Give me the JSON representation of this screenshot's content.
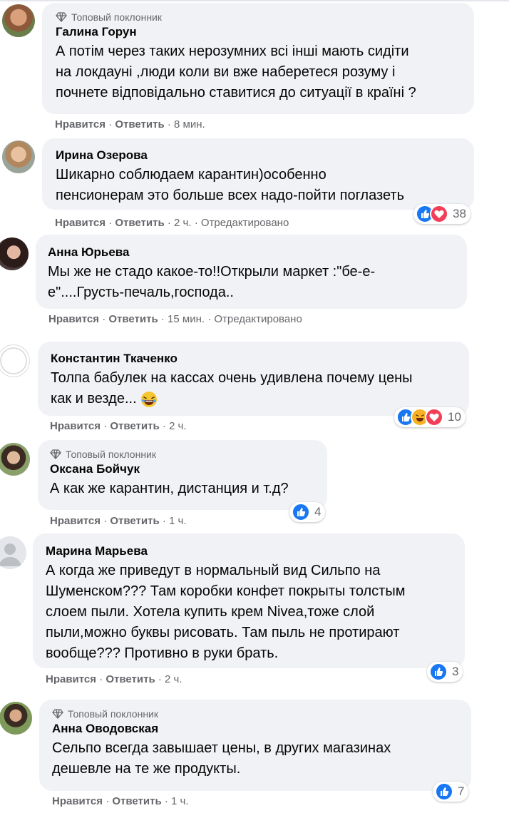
{
  "badge_label": "Топовый поклонник",
  "action_like": "Нравится",
  "action_reply": "Ответить",
  "separator": "·",
  "colors": {
    "bubble": "#f0f2f5",
    "meta": "#65676b",
    "like": "#1877f2",
    "love": "#f33e58",
    "haha": "#f7b125"
  },
  "comments": [
    {
      "author": "Галина Горун",
      "top_fan": true,
      "lines": [
        "А потім через таких нерозумних всі інші мають сидіти",
        "на локдауні ,люди коли ви вже наберетеся розуму і",
        "почнете відповідально ставитися до ситуації в країні ?"
      ],
      "time": "8 мин.",
      "edited": "",
      "reactions": null
    },
    {
      "author": "Ирина Озерова",
      "top_fan": false,
      "lines": [
        "Шикарно соблюдаем карантин)особенно",
        "пенсионерам это больше всех надо-пойти поглазеть"
      ],
      "time": "2 ч.",
      "edited": "Отредактировано",
      "reactions": {
        "icons": [
          "like-icon",
          "love-icon"
        ],
        "count": "38"
      }
    },
    {
      "author": "Анна Юрьева",
      "top_fan": false,
      "lines": [
        "Мы же не стадо какое-то!!Открыли маркет :\"бе-е-",
        "е\"....Грусть-печаль,господа.."
      ],
      "time": "15 мин.",
      "edited": "Отредактировано",
      "reactions": null
    },
    {
      "author": "Константин Ткаченко",
      "top_fan": false,
      "lines": [
        "Толпа бабулек на кассах очень удивлена почему цены",
        "как и везде..."
      ],
      "time": "2 ч.",
      "edited": "",
      "reactions": {
        "icons": [
          "like-icon",
          "haha-icon",
          "love-icon"
        ],
        "count": "10"
      }
    },
    {
      "author": "Оксана Бойчук",
      "top_fan": true,
      "lines": [
        "А как же карантин, дистанция и т.д?"
      ],
      "time": "1 ч.",
      "edited": "",
      "reactions": {
        "icons": [
          "like-icon"
        ],
        "count": "4"
      }
    },
    {
      "author": "Марина Марьева",
      "top_fan": false,
      "lines": [
        "А когда же приведут в нормальный вид Сильпо на",
        "Шуменском??? Там коробки конфет покрыты толстым",
        "слоем пыли. Хотела купить крем Nivea,тоже слой",
        "пыли,можно буквы рисовать. Там пыль не протирают",
        "вообще??? Противно в руки брать."
      ],
      "time": "2 ч.",
      "edited": "",
      "reactions": {
        "icons": [
          "like-icon"
        ],
        "count": "3"
      }
    },
    {
      "author": "Анна Оводовская",
      "top_fan": true,
      "lines": [
        "Сельпо всегда завышает цены, в других магазинах",
        "дешевле на те же продукты."
      ],
      "time": "1 ч.",
      "edited": "",
      "reactions": {
        "icons": [
          "like-icon"
        ],
        "count": "7"
      }
    }
  ]
}
